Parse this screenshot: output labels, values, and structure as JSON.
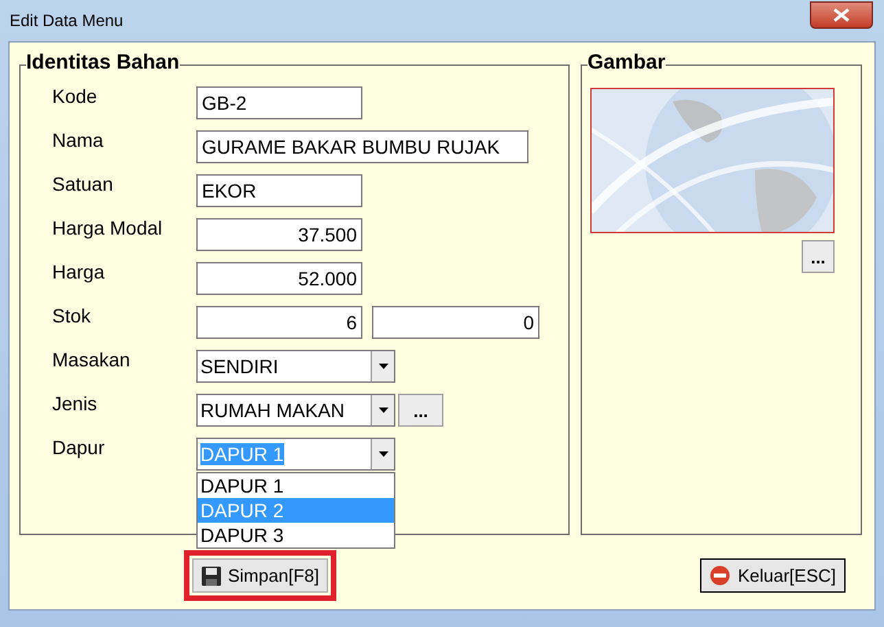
{
  "window": {
    "title": "Edit Data Menu"
  },
  "identitas": {
    "title": "Identitas Bahan",
    "fields": [
      {
        "label": "Kode",
        "kind": "text",
        "value": "GB-2"
      },
      {
        "label": "Nama",
        "kind": "longtext",
        "value": "GURAME BAKAR BUMBU RUJAK"
      },
      {
        "label": "Satuan",
        "kind": "text",
        "value": "EKOR"
      },
      {
        "label": "Harga Modal",
        "kind": "number",
        "value": "37.500"
      },
      {
        "label": "Harga",
        "kind": "number",
        "value": "52.000"
      },
      {
        "label": "Stok",
        "kind": "pair",
        "value": "6",
        "value_2": "0"
      },
      {
        "label": "Masakan",
        "kind": "combo",
        "value": "SENDIRI"
      },
      {
        "label": "Jenis",
        "kind": "combo",
        "value": "RUMAH MAKAN",
        "button": "..."
      },
      {
        "label": "Dapur",
        "kind": "combo",
        "value": "DAPUR 1",
        "focused": true,
        "options": [
          {
            "label": "DAPUR 1",
            "highlighted": false
          },
          {
            "label": "DAPUR 2",
            "highlighted": true
          },
          {
            "label": "DAPUR 3",
            "highlighted": false
          }
        ]
      }
    ]
  },
  "gambar": {
    "title": "Gambar",
    "browse_button": "..."
  },
  "buttons": [
    {
      "label": "Simpan[F8]",
      "highlighted": true,
      "focused": false
    },
    {
      "label": "Keluar[ESC]",
      "highlighted": false,
      "focused": true
    }
  ]
}
